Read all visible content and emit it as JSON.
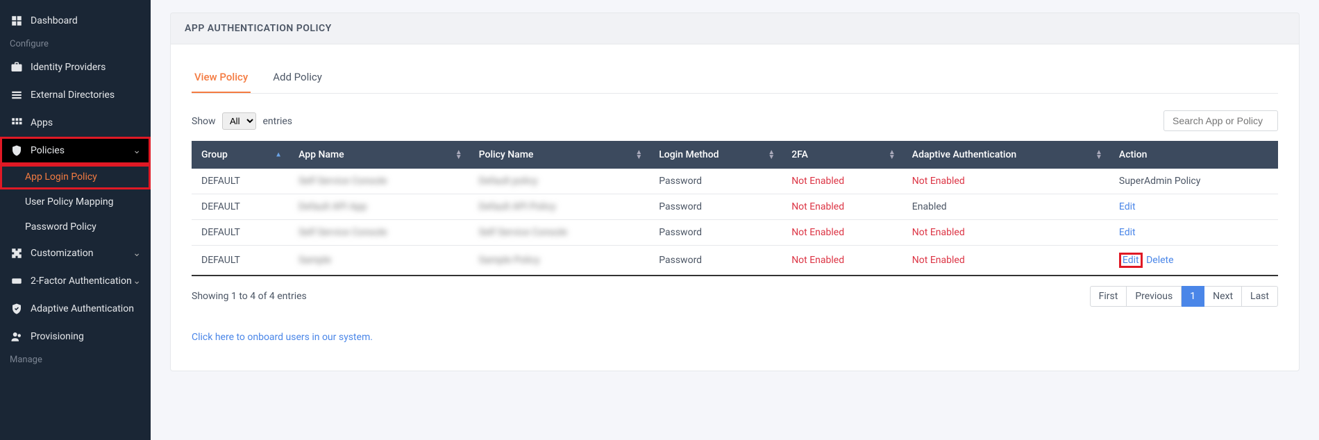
{
  "sidebar": {
    "dashboard": "Dashboard",
    "configure_label": "Configure",
    "identity_providers": "Identity Providers",
    "external_directories": "External Directories",
    "apps": "Apps",
    "policies": "Policies",
    "app_login_policy": "App Login Policy",
    "user_policy_mapping": "User Policy Mapping",
    "password_policy": "Password Policy",
    "customization": "Customization",
    "two_factor": "2-Factor Authentication",
    "adaptive_auth": "Adaptive Authentication",
    "provisioning": "Provisioning",
    "manage_label": "Manage"
  },
  "page_title": "APP AUTHENTICATION POLICY",
  "tabs": {
    "view_policy": "View Policy",
    "add_policy": "Add Policy"
  },
  "entries_control": {
    "show": "Show",
    "entries": "entries",
    "selected": "All"
  },
  "search_placeholder": "Search App or Policy",
  "columns": {
    "group": "Group",
    "app_name": "App Name",
    "policy_name": "Policy Name",
    "login_method": "Login Method",
    "two_fa": "2FA",
    "adaptive_auth": "Adaptive Authentication",
    "action": "Action"
  },
  "rows": [
    {
      "group": "DEFAULT",
      "app_name": "Self Service Console",
      "policy_name": "Default policy",
      "login_method": "Password",
      "two_fa": "Not Enabled",
      "adaptive": "Not Enabled",
      "action_label": "SuperAdmin Policy",
      "action_type": "text"
    },
    {
      "group": "DEFAULT",
      "app_name": "Default API App",
      "policy_name": "Default API Policy",
      "login_method": "Password",
      "two_fa": "Not Enabled",
      "adaptive": "Enabled",
      "action_label": "Edit",
      "action_type": "edit"
    },
    {
      "group": "DEFAULT",
      "app_name": "Self Service Console",
      "policy_name": "Self Service Console",
      "login_method": "Password",
      "two_fa": "Not Enabled",
      "adaptive": "Not Enabled",
      "action_label": "Edit",
      "action_type": "edit"
    },
    {
      "group": "DEFAULT",
      "app_name": "Sample",
      "policy_name": "Sample Policy",
      "login_method": "Password",
      "two_fa": "Not Enabled",
      "adaptive": "Not Enabled",
      "action_label": "Edit",
      "action_type": "edit_delete",
      "delete_label": "Delete"
    }
  ],
  "footer_info": "Showing 1 to 4 of 4 entries",
  "pagination": {
    "first": "First",
    "previous": "Previous",
    "page1": "1",
    "next": "Next",
    "last": "Last"
  },
  "onboard_link": "Click here to onboard users in our system."
}
